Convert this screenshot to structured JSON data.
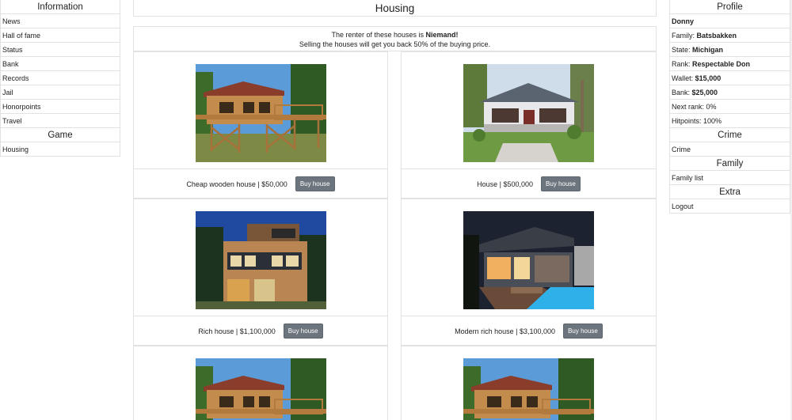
{
  "left_sidebar": {
    "information_header": "Information",
    "information_items": [
      "News",
      "Hall of fame",
      "Status",
      "Bank",
      "Records",
      "Jail",
      "Honorpoints",
      "Travel"
    ],
    "game_header": "Game",
    "game_items": [
      "Housing"
    ]
  },
  "main": {
    "title": "Housing",
    "notice_line1_prefix": "The renter of these houses is ",
    "notice_renter": "Niemand!",
    "notice_line2": "Selling the houses will get you back 50% of the buying price.",
    "houses": [
      {
        "label": "Cheap wooden house | $50,000",
        "button": "Buy house",
        "image": "wooden-stilt-house"
      },
      {
        "label": "House | $500,000",
        "button": "Buy house",
        "image": "bungalow-house"
      },
      {
        "label": "Rich house | $1,100,000",
        "button": "Buy house",
        "image": "wood-clad-modern-house"
      },
      {
        "label": "Modern rich house | $3,100,000",
        "button": "Buy house",
        "image": "modern-house-with-pool"
      }
    ]
  },
  "right_sidebar": {
    "profile_header": "Profile",
    "username": "Donny",
    "family_label": "Family: ",
    "family_value": "Batsbakken",
    "state_label": "State: ",
    "state_value": "Michigan",
    "rank_label": "Rank: ",
    "rank_value": "Respectable Don",
    "wallet_label": "Wallet: ",
    "wallet_value": "$15,000",
    "bank_label": "Bank: ",
    "bank_value": "$25,000",
    "next_rank": "Next rank: 0%",
    "hitpoints": "Hitpoints: 100%",
    "crime_header": "Crime",
    "crime_item": "Crime",
    "family_header": "Family",
    "family_item": "Family list",
    "extra_header": "Extra",
    "logout": "Logout"
  },
  "colors": {
    "button_bg": "#6c757d",
    "border": "#e2e2e2"
  }
}
